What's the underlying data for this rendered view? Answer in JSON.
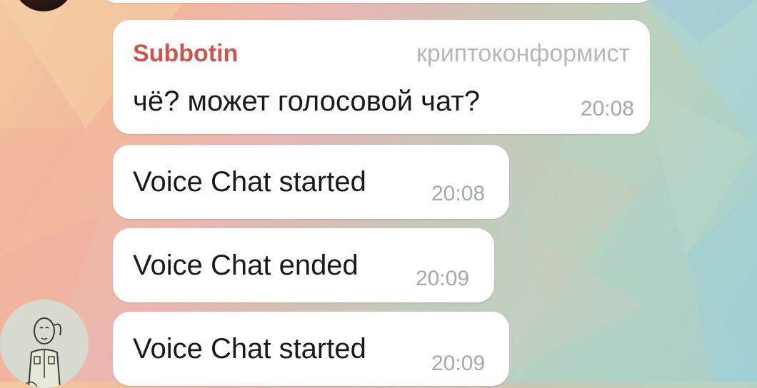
{
  "messages": [
    {
      "sender": "Subbotin",
      "rank": "криптоконформист",
      "text": "чё? может голосовой чат?",
      "time": "20:08"
    },
    {
      "text": "Voice Chat started",
      "time": "20:08"
    },
    {
      "text": "Voice Chat ended",
      "time": "20:09"
    },
    {
      "text": "Voice Chat started",
      "time": "20:09"
    }
  ],
  "colors": {
    "sender_name": "#c8584f",
    "rank": "#b7b7b7",
    "timestamp": "#a2a9b0",
    "bubble": "#ffffff"
  }
}
